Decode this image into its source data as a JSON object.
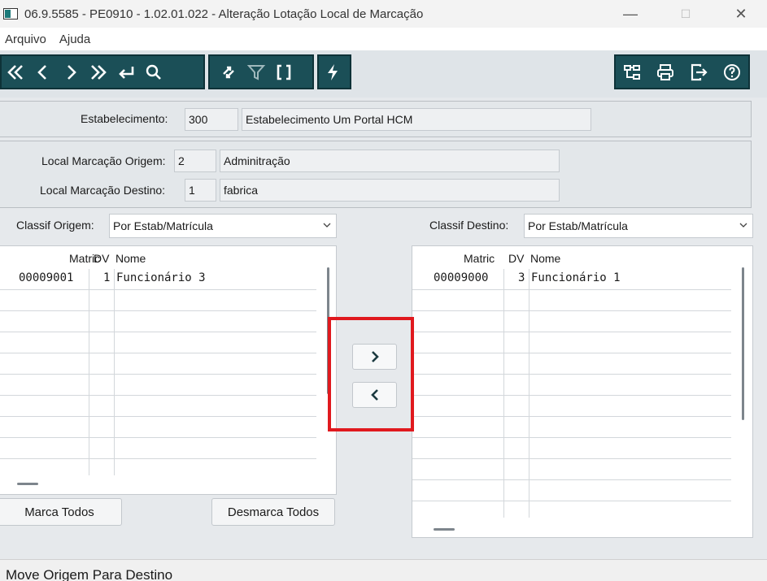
{
  "window": {
    "title": "06.9.5585 - PE0910 - 1.02.01.022 - Alteração Lotação Local de Marcação",
    "minimize": "—",
    "maximize": "☐",
    "close": "✕"
  },
  "menu": {
    "items": [
      "Arquivo",
      "Ajuda"
    ]
  },
  "toolbar": {
    "nav_icons": [
      "first-icon",
      "previous-icon",
      "next-icon",
      "last-icon",
      "return-icon",
      "search-icon"
    ],
    "filter_icons": [
      "refresh-icon",
      "filter-icon",
      "brackets-icon"
    ],
    "action_icons": [
      "lightning-icon"
    ],
    "right_icons": [
      "tree-icon",
      "print-icon",
      "exit-icon",
      "help-icon"
    ],
    "colors": {
      "background": "#1b4f57",
      "icon": "#ffffff"
    }
  },
  "estabelecimento": {
    "label": "Estabelecimento:",
    "code": "300",
    "name": "Estabelecimento Um Portal HCM"
  },
  "local_origem": {
    "label": "Local Marcação Origem:",
    "code": "2",
    "name": "Adminitração"
  },
  "local_destino": {
    "label": "Local Marcação Destino:",
    "code": "1",
    "name": "fabrica"
  },
  "origem": {
    "classif_label": "Classif Origem:",
    "classif_value": "Por Estab/Matrícula",
    "columns": [
      "Matric",
      "DV",
      "Nome"
    ],
    "rows": [
      {
        "matric": "00009001",
        "dv": "1",
        "nome": "Funcionário 3"
      }
    ],
    "marca_todos": "Marca Todos",
    "desmarca_todos": "Desmarca Todos"
  },
  "destino": {
    "classif_label": "Classif Destino:",
    "classif_value": "Por Estab/Matrícula",
    "columns": [
      "Matric",
      "DV",
      "Nome"
    ],
    "rows": [
      {
        "matric": "00009000",
        "dv": "3",
        "nome": "Funcionário 1"
      }
    ]
  },
  "move": {
    "to_destino": "›",
    "to_origem": "‹"
  },
  "highlight_color": "#e0191e",
  "status": {
    "text": "Move Origem Para Destino"
  }
}
